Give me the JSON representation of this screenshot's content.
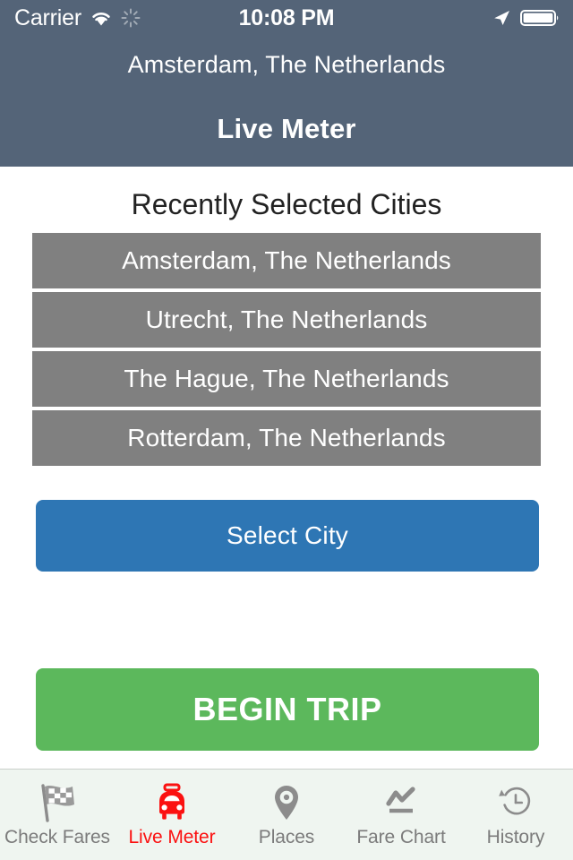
{
  "status_bar": {
    "carrier": "Carrier",
    "time": "10:08 PM",
    "icons": [
      "wifi-icon",
      "activity-spinner-icon",
      "location-arrow-icon",
      "battery-icon"
    ]
  },
  "header": {
    "subtitle": "Amsterdam, The Netherlands",
    "title": "Live Meter",
    "background_color": "#546478"
  },
  "main": {
    "section_title": "Recently Selected Cities",
    "cities": [
      {
        "label": "Amsterdam, The Netherlands"
      },
      {
        "label": "Utrecht, The Netherlands"
      },
      {
        "label": "The Hague, The Netherlands"
      },
      {
        "label": "Rotterdam, The Netherlands"
      }
    ],
    "city_row_color": "#808080",
    "select_city_button": {
      "label": "Select City",
      "color": "#2e76b4"
    },
    "begin_trip_button": {
      "label": "BEGIN TRIP",
      "color": "#5cb85c"
    }
  },
  "tabbar": {
    "active_color": "#fb1111",
    "inactive_color": "#7b7b7b",
    "items": [
      {
        "label": "Check Fares",
        "icon": "checkered-flag-icon",
        "active": false
      },
      {
        "label": "Live Meter",
        "icon": "taxi-car-icon",
        "active": true
      },
      {
        "label": "Places",
        "icon": "map-pin-icon",
        "active": false
      },
      {
        "label": "Fare Chart",
        "icon": "line-chart-icon",
        "active": false
      },
      {
        "label": "History",
        "icon": "clock-history-icon",
        "active": false
      }
    ]
  }
}
